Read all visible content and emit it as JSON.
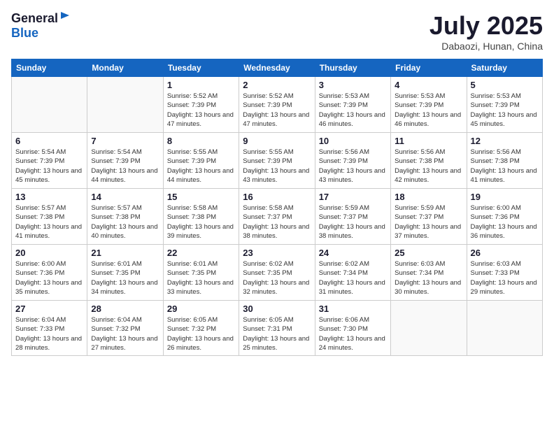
{
  "header": {
    "logo_general": "General",
    "logo_blue": "Blue",
    "month_year": "July 2025",
    "location": "Dabaozi, Hunan, China"
  },
  "weekdays": [
    "Sunday",
    "Monday",
    "Tuesday",
    "Wednesday",
    "Thursday",
    "Friday",
    "Saturday"
  ],
  "weeks": [
    [
      {
        "day": "",
        "detail": ""
      },
      {
        "day": "",
        "detail": ""
      },
      {
        "day": "1",
        "detail": "Sunrise: 5:52 AM\nSunset: 7:39 PM\nDaylight: 13 hours and 47 minutes."
      },
      {
        "day": "2",
        "detail": "Sunrise: 5:52 AM\nSunset: 7:39 PM\nDaylight: 13 hours and 47 minutes."
      },
      {
        "day": "3",
        "detail": "Sunrise: 5:53 AM\nSunset: 7:39 PM\nDaylight: 13 hours and 46 minutes."
      },
      {
        "day": "4",
        "detail": "Sunrise: 5:53 AM\nSunset: 7:39 PM\nDaylight: 13 hours and 46 minutes."
      },
      {
        "day": "5",
        "detail": "Sunrise: 5:53 AM\nSunset: 7:39 PM\nDaylight: 13 hours and 45 minutes."
      }
    ],
    [
      {
        "day": "6",
        "detail": "Sunrise: 5:54 AM\nSunset: 7:39 PM\nDaylight: 13 hours and 45 minutes."
      },
      {
        "day": "7",
        "detail": "Sunrise: 5:54 AM\nSunset: 7:39 PM\nDaylight: 13 hours and 44 minutes."
      },
      {
        "day": "8",
        "detail": "Sunrise: 5:55 AM\nSunset: 7:39 PM\nDaylight: 13 hours and 44 minutes."
      },
      {
        "day": "9",
        "detail": "Sunrise: 5:55 AM\nSunset: 7:39 PM\nDaylight: 13 hours and 43 minutes."
      },
      {
        "day": "10",
        "detail": "Sunrise: 5:56 AM\nSunset: 7:39 PM\nDaylight: 13 hours and 43 minutes."
      },
      {
        "day": "11",
        "detail": "Sunrise: 5:56 AM\nSunset: 7:38 PM\nDaylight: 13 hours and 42 minutes."
      },
      {
        "day": "12",
        "detail": "Sunrise: 5:56 AM\nSunset: 7:38 PM\nDaylight: 13 hours and 41 minutes."
      }
    ],
    [
      {
        "day": "13",
        "detail": "Sunrise: 5:57 AM\nSunset: 7:38 PM\nDaylight: 13 hours and 41 minutes."
      },
      {
        "day": "14",
        "detail": "Sunrise: 5:57 AM\nSunset: 7:38 PM\nDaylight: 13 hours and 40 minutes."
      },
      {
        "day": "15",
        "detail": "Sunrise: 5:58 AM\nSunset: 7:38 PM\nDaylight: 13 hours and 39 minutes."
      },
      {
        "day": "16",
        "detail": "Sunrise: 5:58 AM\nSunset: 7:37 PM\nDaylight: 13 hours and 38 minutes."
      },
      {
        "day": "17",
        "detail": "Sunrise: 5:59 AM\nSunset: 7:37 PM\nDaylight: 13 hours and 38 minutes."
      },
      {
        "day": "18",
        "detail": "Sunrise: 5:59 AM\nSunset: 7:37 PM\nDaylight: 13 hours and 37 minutes."
      },
      {
        "day": "19",
        "detail": "Sunrise: 6:00 AM\nSunset: 7:36 PM\nDaylight: 13 hours and 36 minutes."
      }
    ],
    [
      {
        "day": "20",
        "detail": "Sunrise: 6:00 AM\nSunset: 7:36 PM\nDaylight: 13 hours and 35 minutes."
      },
      {
        "day": "21",
        "detail": "Sunrise: 6:01 AM\nSunset: 7:35 PM\nDaylight: 13 hours and 34 minutes."
      },
      {
        "day": "22",
        "detail": "Sunrise: 6:01 AM\nSunset: 7:35 PM\nDaylight: 13 hours and 33 minutes."
      },
      {
        "day": "23",
        "detail": "Sunrise: 6:02 AM\nSunset: 7:35 PM\nDaylight: 13 hours and 32 minutes."
      },
      {
        "day": "24",
        "detail": "Sunrise: 6:02 AM\nSunset: 7:34 PM\nDaylight: 13 hours and 31 minutes."
      },
      {
        "day": "25",
        "detail": "Sunrise: 6:03 AM\nSunset: 7:34 PM\nDaylight: 13 hours and 30 minutes."
      },
      {
        "day": "26",
        "detail": "Sunrise: 6:03 AM\nSunset: 7:33 PM\nDaylight: 13 hours and 29 minutes."
      }
    ],
    [
      {
        "day": "27",
        "detail": "Sunrise: 6:04 AM\nSunset: 7:33 PM\nDaylight: 13 hours and 28 minutes."
      },
      {
        "day": "28",
        "detail": "Sunrise: 6:04 AM\nSunset: 7:32 PM\nDaylight: 13 hours and 27 minutes."
      },
      {
        "day": "29",
        "detail": "Sunrise: 6:05 AM\nSunset: 7:32 PM\nDaylight: 13 hours and 26 minutes."
      },
      {
        "day": "30",
        "detail": "Sunrise: 6:05 AM\nSunset: 7:31 PM\nDaylight: 13 hours and 25 minutes."
      },
      {
        "day": "31",
        "detail": "Sunrise: 6:06 AM\nSunset: 7:30 PM\nDaylight: 13 hours and 24 minutes."
      },
      {
        "day": "",
        "detail": ""
      },
      {
        "day": "",
        "detail": ""
      }
    ]
  ]
}
